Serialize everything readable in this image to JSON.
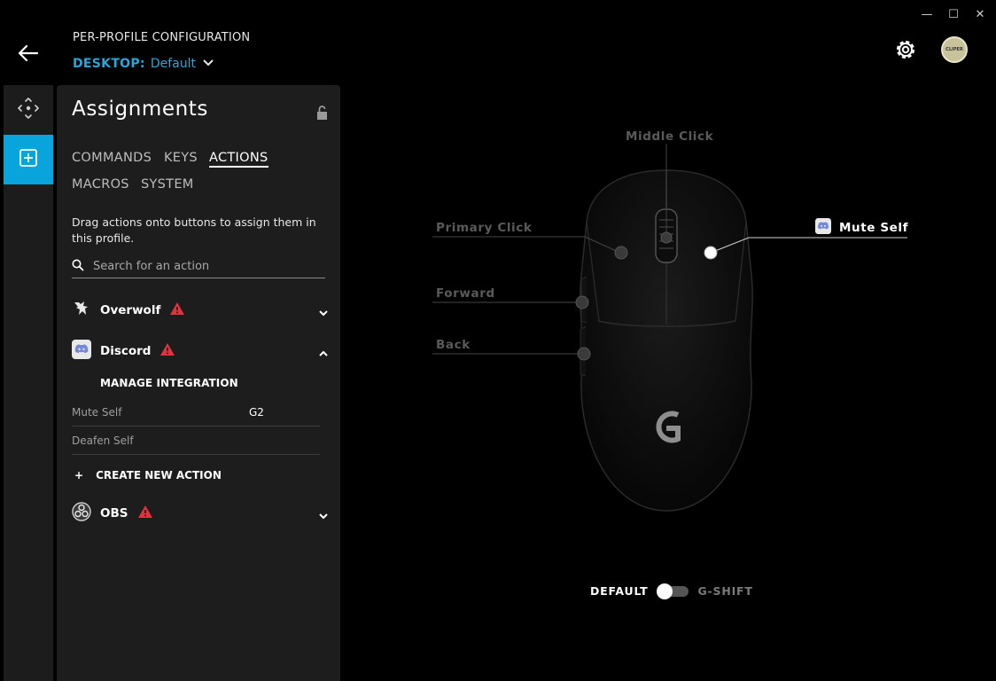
{
  "window": {
    "minimize_glyph": "—",
    "maximize_glyph": "☐",
    "close_glyph": "✕"
  },
  "header": {
    "title": "PER-PROFILE CONFIGURATION",
    "profile_key": "DESKTOP:",
    "profile_value": "Default",
    "avatar_text": "CLIPER"
  },
  "panel": {
    "title": "Assignments",
    "tabs": [
      {
        "label": "COMMANDS",
        "active": false
      },
      {
        "label": "KEYS",
        "active": false
      },
      {
        "label": "ACTIONS",
        "active": true
      },
      {
        "label": "MACROS",
        "active": false
      },
      {
        "label": "SYSTEM",
        "active": false
      }
    ],
    "hint": "Drag actions onto buttons to assign them in this profile.",
    "search_placeholder": "Search for an action",
    "groups": [
      {
        "name": "Overwolf",
        "warning": true,
        "expanded": false
      },
      {
        "name": "Discord",
        "warning": true,
        "expanded": true
      },
      {
        "name": "OBS",
        "warning": true,
        "expanded": false
      }
    ],
    "manage_integration": "MANAGE INTEGRATION",
    "actions": [
      {
        "name": "Mute Self",
        "key": "G2"
      },
      {
        "name": "Deafen Self",
        "key": ""
      }
    ],
    "create_action": "CREATE NEW ACTION"
  },
  "mouse": {
    "callouts": {
      "middle": "Middle Click",
      "primary": "Primary Click",
      "secondary": "Mute Self",
      "forward": "Forward",
      "back": "Back"
    },
    "logo": "G"
  },
  "mode_toggle": {
    "left_label": "DEFAULT",
    "right_label": "G-SHIFT",
    "state": "DEFAULT"
  },
  "colors": {
    "accent": "#0aa4dd",
    "warning": "#e0333d",
    "discord": "#7289da"
  }
}
